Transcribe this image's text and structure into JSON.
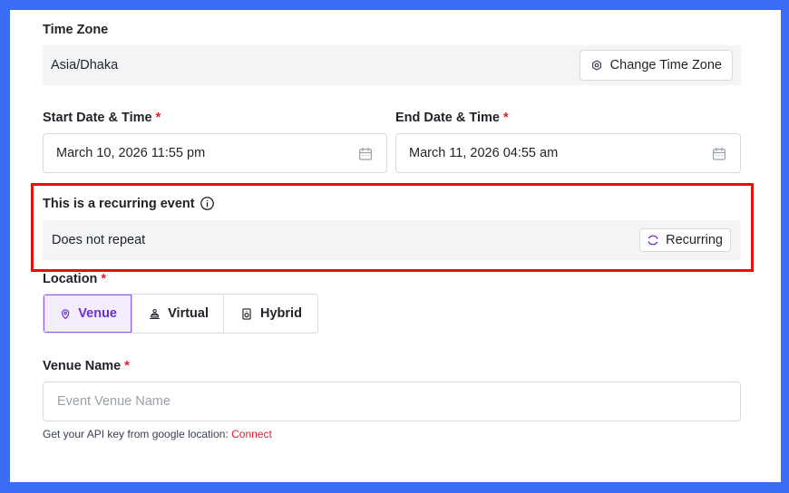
{
  "time_zone": {
    "label": "Time Zone",
    "value": "Asia/Dhaka",
    "change_button": "Change Time Zone",
    "button_icon": "gear-icon"
  },
  "start": {
    "label": "Start Date & Time",
    "required_mark": "*",
    "value": "March 10, 2026 11:55 pm",
    "icon": "calendar-icon"
  },
  "end": {
    "label": "End Date & Time",
    "required_mark": "*",
    "value": "March 11, 2026 04:55 am",
    "icon": "calendar-icon"
  },
  "recurring": {
    "label": "This is a recurring event",
    "info_icon": "info-icon",
    "value": "Does not repeat",
    "button": "Recurring",
    "button_icon": "repeat-icon"
  },
  "location": {
    "label": "Location",
    "required_mark": "*",
    "selected": "Venue",
    "options": [
      {
        "label": "Venue",
        "icon": "map-pin-icon"
      },
      {
        "label": "Virtual",
        "icon": "user-laptop-icon"
      },
      {
        "label": "Hybrid",
        "icon": "speaker-icon"
      }
    ]
  },
  "venue": {
    "label": "Venue Name",
    "required_mark": "*",
    "placeholder": "Event Venue Name",
    "value": ""
  },
  "help": {
    "text": "Get your API key from google location:",
    "link": "Connect"
  },
  "colors": {
    "background": "#3b6cf6",
    "accent": "#6a2fd3",
    "required": "#e11d2e",
    "highlight": "#e01010"
  }
}
